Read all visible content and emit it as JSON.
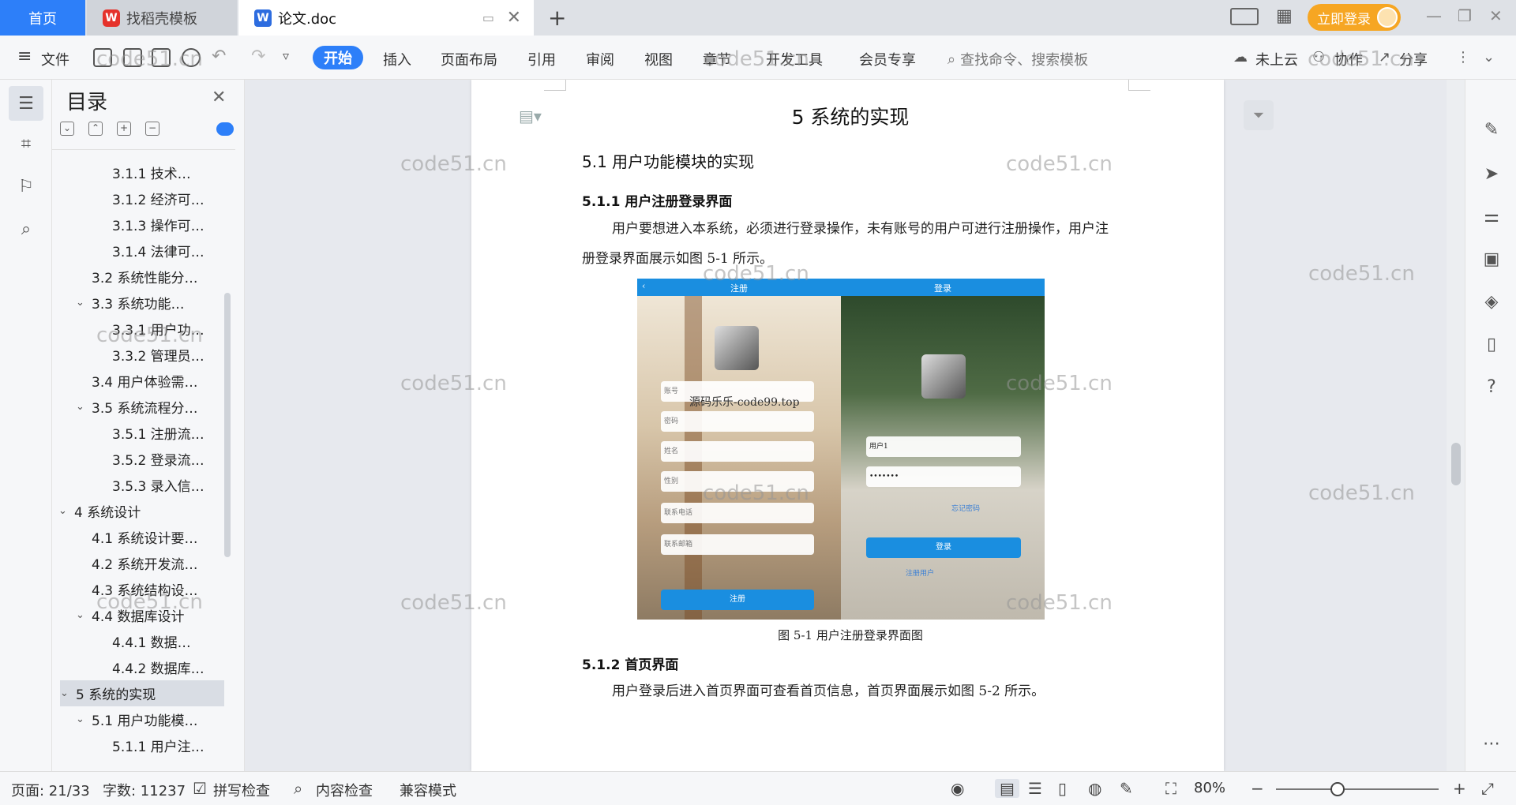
{
  "tabs": {
    "home": "首页",
    "template": "找稻壳模板",
    "document": "论文.doc",
    "login": "立即登录"
  },
  "toolbar": {
    "file": "文件",
    "menus": [
      "开始",
      "插入",
      "页面布局",
      "引用",
      "审阅",
      "视图",
      "章节",
      "开发工具",
      "会员专享"
    ],
    "search_placeholder": "查找命令、搜索模板",
    "cloud": "未上云",
    "collab": "协作",
    "share": "分享"
  },
  "toc": {
    "title": "目录",
    "items": [
      {
        "label": "3.1.1  技术…",
        "level": 3
      },
      {
        "label": "3.1.2 经济可…",
        "level": 3
      },
      {
        "label": "3.1.3 操作可…",
        "level": 3
      },
      {
        "label": "3.1.4 法律可…",
        "level": 3
      },
      {
        "label": "3.2 系统性能分…",
        "level": 2
      },
      {
        "label": "3.3   系统功能…",
        "level": 2,
        "expanded": true
      },
      {
        "label": "3.3.1 用户功…",
        "level": 3
      },
      {
        "label": "3.3.2 管理员…",
        "level": 3
      },
      {
        "label": "3.4 用户体验需…",
        "level": 2
      },
      {
        "label": "3.5 系统流程分…",
        "level": 2,
        "expanded": true
      },
      {
        "label": "3.5.1 注册流…",
        "level": 3
      },
      {
        "label": "3.5.2 登录流…",
        "level": 3
      },
      {
        "label": "3.5.3 录入信…",
        "level": 3
      },
      {
        "label": "4 系统设计",
        "level": 1,
        "expanded": true
      },
      {
        "label": "4.1 系统设计要…",
        "level": 2
      },
      {
        "label": "4.2 系统开发流…",
        "level": 2
      },
      {
        "label": "4.3 系统结构设…",
        "level": 2
      },
      {
        "label": "4.4 数据库设计",
        "level": 2,
        "expanded": true
      },
      {
        "label": "4.4.1 数据…",
        "level": 3
      },
      {
        "label": "4.4.2 数据库…",
        "level": 3
      },
      {
        "label": "5  系统的实现",
        "level": 1,
        "expanded": true,
        "selected": true
      },
      {
        "label": "5.1 用户功能模…",
        "level": 2,
        "expanded": true
      },
      {
        "label": "5.1.1 用户注…",
        "level": 3
      }
    ]
  },
  "document": {
    "heading1": "5  系统的实现",
    "heading2": "5.1 用户功能模块的实现",
    "heading3a": "5.1.1 用户注册登录界面",
    "para1": "用户要想进入本系统，必须进行登录操作，未有账号的用户可进行注册操作，用户注册登录界面展示如图 5-1 所示。",
    "figure": {
      "tab_register": "注册",
      "tab_login": "登录",
      "overlay_text": "源码乐乐-code99.top",
      "left_fields": [
        "账号",
        "密码",
        "姓名",
        "性别",
        "联系电话",
        "联系邮箱"
      ],
      "left_button": "注册",
      "right_fields": [
        "用户1",
        "•••••••"
      ],
      "right_link": "忘记密码",
      "right_button": "登录",
      "right_register": "注册用户"
    },
    "caption": "图 5-1  用户注册登录界面图",
    "heading3b": "5.1.2 首页界面",
    "para2": "用户登录后进入首页界面可查看首页信息，首页界面展示如图 5-2 所示。"
  },
  "watermark": "code51.cn",
  "status": {
    "page": "页面: 21/33",
    "words": "字数: 11237",
    "spell": "拼写检查",
    "content": "内容检查",
    "compat": "兼容模式",
    "zoom": "80%"
  },
  "colors": {
    "accent": "#2d7ff9",
    "login": "#f6a623"
  }
}
